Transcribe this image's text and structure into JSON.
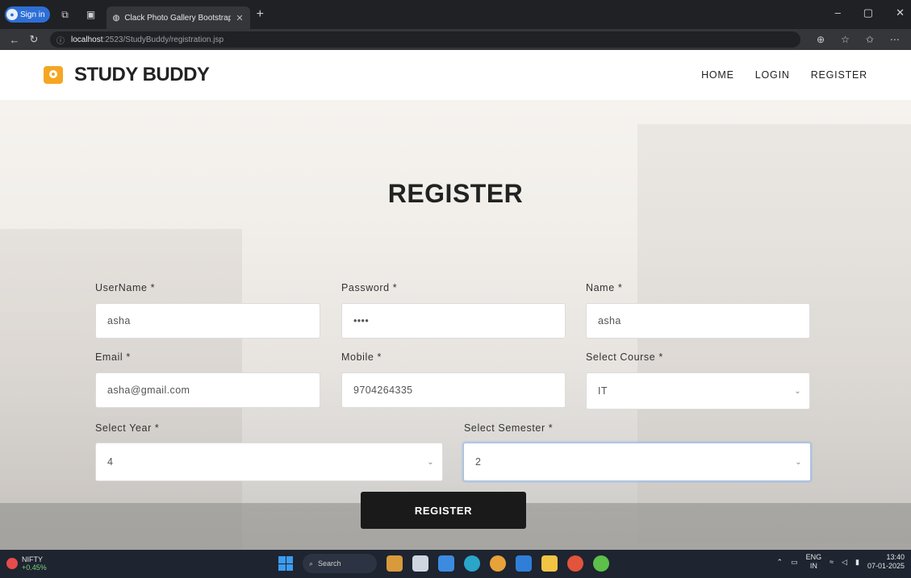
{
  "browser": {
    "sign_in": "Sign in",
    "tab_title": "Clack Photo Gallery Bootstrap Re",
    "url_host": "localhost",
    "url_path": ":2523/StudyBuddy/registration.jsp"
  },
  "navbar": {
    "brand": "STUDY BUDDY",
    "links": [
      "HOME",
      "LOGIN",
      "REGISTER"
    ]
  },
  "form": {
    "title": "REGISTER",
    "fields": {
      "username": {
        "label": "UserName *",
        "value": "asha"
      },
      "password": {
        "label": "Password *",
        "value": "••••"
      },
      "name": {
        "label": "Name *",
        "value": "asha"
      },
      "email": {
        "label": "Email *",
        "value": "asha@gmail.com"
      },
      "mobile": {
        "label": "Mobile *",
        "value": "9704264335"
      },
      "course": {
        "label": "Select Course *",
        "value": "IT"
      },
      "year": {
        "label": "Select Year *",
        "value": "4"
      },
      "semester": {
        "label": "Select Semester *",
        "value": "2"
      }
    },
    "submit": "REGISTER"
  },
  "taskbar": {
    "ticker_name": "NIFTY",
    "ticker_change": "+0.45%",
    "search": "Search",
    "lang_top": "ENG",
    "lang_bottom": "IN",
    "time": "13:40",
    "date": "07-01-2025"
  }
}
